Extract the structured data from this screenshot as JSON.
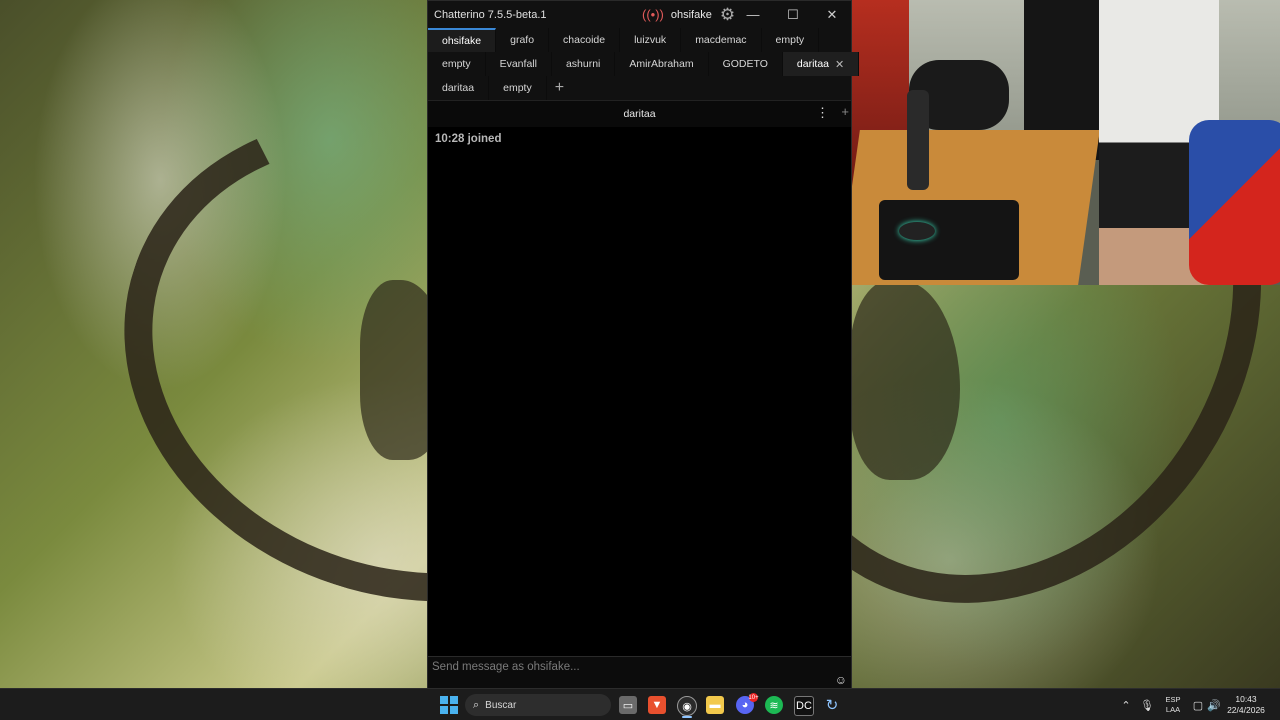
{
  "window": {
    "title": "Chatterino 7.5.5-beta.1",
    "account": "ohsifake",
    "icons": {
      "live": "live-broadcast-icon",
      "settings": "gear-icon",
      "minimize": "minimize-icon",
      "maximize": "maximize-icon",
      "close": "close-icon"
    }
  },
  "tabs": {
    "rows": [
      [
        "ohsifake",
        "grafo",
        "chacoide",
        "luizvuk",
        "macdemac",
        "empty"
      ],
      [
        "empty",
        "Evanfall",
        "ashurni",
        "AmirAbraham",
        "GODETO",
        "daritaa"
      ],
      [
        "daritaa",
        "empty"
      ]
    ],
    "add_label": "+",
    "accent_color": "#3a88d6"
  },
  "split": {
    "channel": "daritaa",
    "menu_icon": "vertical-dots-icon",
    "add_icon": "plus-icon"
  },
  "messages": [
    {
      "time": "10:28",
      "text": "joined",
      "display": "10:28 joined"
    }
  ],
  "input": {
    "placeholder": "Send message as ohsifake...",
    "emoji_icon": "emoji-icon"
  },
  "taskbar": {
    "search_label": "Buscar",
    "apps": [
      "windows-start-icon",
      "file-explorer-icon",
      "brave-browser-icon",
      "chatterino-icon",
      "folder-icon",
      "discord-icon",
      "spotify-icon",
      "dc-app-icon",
      "refresh-app-icon"
    ],
    "discord_badge": "10+",
    "language": {
      "line1": "ESP",
      "line2": "LAA"
    },
    "time": "10:43",
    "date": "22/4/2026"
  }
}
